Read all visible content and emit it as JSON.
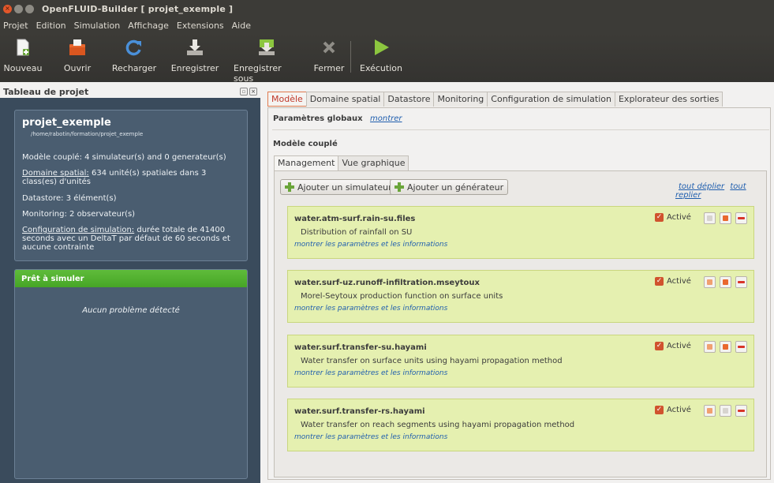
{
  "window": {
    "title": "OpenFLUID-Builder [ projet_exemple ]"
  },
  "menu": [
    {
      "label": "Projet"
    },
    {
      "label": "Edition"
    },
    {
      "label": "Simulation"
    },
    {
      "label": "Affichage"
    },
    {
      "label": "Extensions"
    },
    {
      "label": "Aide"
    }
  ],
  "toolbar": {
    "nouveau": "Nouveau",
    "ouvrir": "Ouvrir",
    "recharger": "Recharger",
    "enregistrer": "Enregistrer",
    "enregistrer_sous": "Enregistrer sous",
    "fermer": "Fermer",
    "execution": "Exécution"
  },
  "left": {
    "header": "Tableau de projet",
    "project_name": "projet_exemple",
    "project_path": "/home/rabotin/formation/projet_exemple",
    "model_line": "Modèle couplé: 4 simulateur(s) and 0 generateur(s)",
    "domain_label": "Domaine spatial:",
    "domain_text": " 634 unité(s) spatiales dans 3 class(es) d'unités",
    "datastore_line": "Datastore: 3 élément(s)",
    "monitoring_line": "Monitoring: 2 observateur(s)",
    "config_label": "Configuration de simulation:",
    "config_text": " durée totale de 41400 seconds avec un DeltaT par défaut de 60 seconds et aucune contrainte",
    "ready_title": "Prêt à simuler",
    "ready_msg": "Aucun problème détecté"
  },
  "tabs": {
    "modele": "Modèle",
    "domaine": "Domaine spatial",
    "datastore": "Datastore",
    "monitoring": "Monitoring",
    "config": "Configuration de simulation",
    "explorateur": "Explorateur des sorties"
  },
  "main": {
    "global_params": "Paramètres globaux",
    "show": "montrer",
    "coupled_model": "Modèle couplé",
    "subtab_management": "Management",
    "subtab_graph": "Vue graphique",
    "add_simulator": "Ajouter un simulateur",
    "add_generator": "Ajouter un générateur",
    "expand_all": "tout déplier",
    "collapse_all": "tout replier"
  },
  "simulators": [
    {
      "id": "water.atm-surf.rain-su.files",
      "desc": "Distribution of rainfall on SU",
      "link": "montrer les paramètres et les informations",
      "active": "Activé"
    },
    {
      "id": "water.surf-uz.runoff-infiltration.mseytoux",
      "desc": "Morel-Seytoux production function on surface units",
      "link": "montrer les paramètres et les informations",
      "active": "Activé"
    },
    {
      "id": "water.surf.transfer-su.hayami",
      "desc": "Water transfer on surface units using hayami propagation method",
      "link": "montrer les paramètres et les informations",
      "active": "Activé"
    },
    {
      "id": "water.surf.transfer-rs.hayami",
      "desc": "Water transfer on reach segments using hayami propagation method",
      "link": "montrer les paramètres et les informations",
      "active": "Activé"
    }
  ]
}
